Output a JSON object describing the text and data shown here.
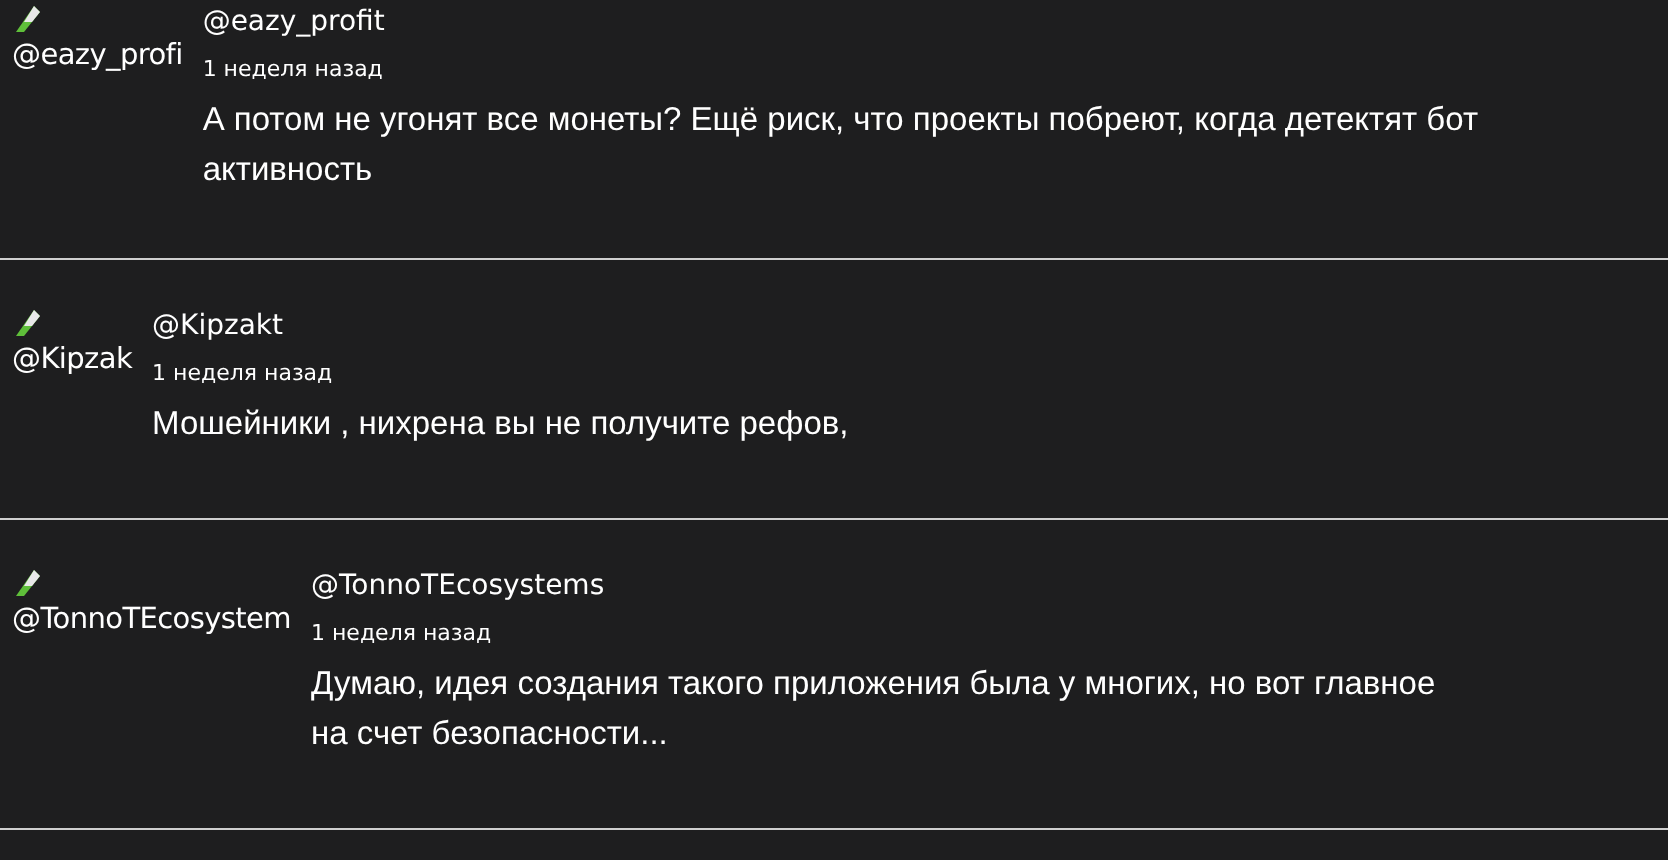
{
  "comments": [
    {
      "avatar_alt": "@eazy_profi",
      "author": "@eazy_profit",
      "time": "1 неделя назад",
      "lines": [
        "А потом не угонят все монеты? Ещё риск, что проекты побреют, когда детектят бот",
        "активность"
      ]
    },
    {
      "avatar_alt": "@Kipzak",
      "author": "@Kipzakt",
      "time": "1 неделя назад",
      "lines": [
        "Мошейники , нихрена вы не получите рефов,"
      ]
    },
    {
      "avatar_alt": "@TonnoTEcosystem",
      "author": "@TonnoTEcosystems",
      "time": "1 неделя назад",
      "lines": [
        "Думаю, идея создания такого приложения была у многих, но вот главное",
        "на счет безопасности..."
      ]
    }
  ]
}
